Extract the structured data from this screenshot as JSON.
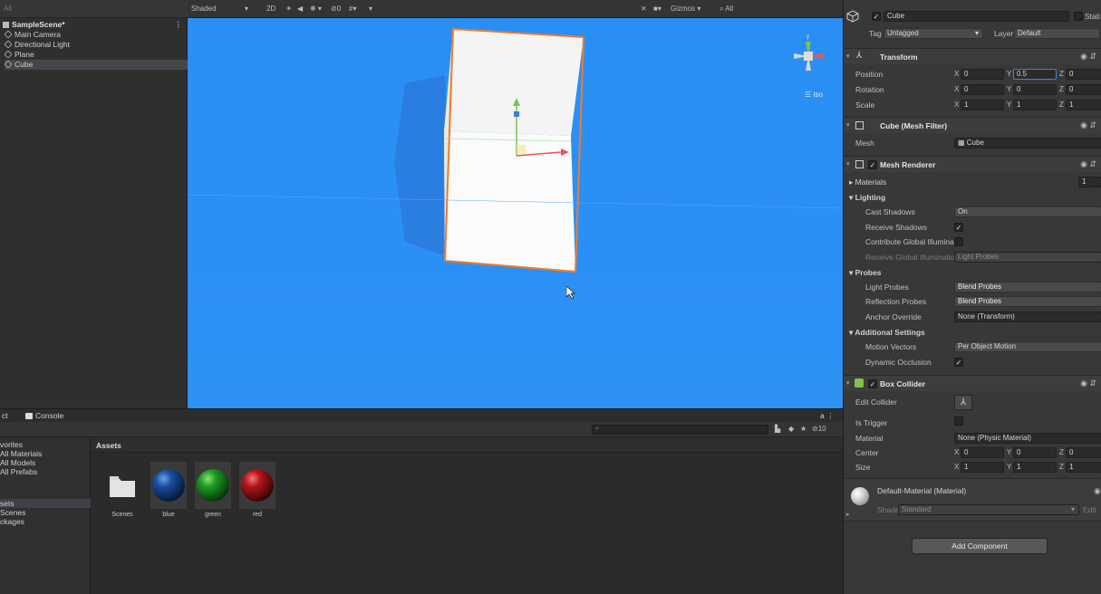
{
  "hierarchy": {
    "search_placeholder": "All",
    "scene_name": "SampleScene*",
    "items": [
      "Main Camera",
      "Directional Light",
      "Plane",
      "Cube"
    ],
    "selected": "Cube"
  },
  "scene_toolbar": {
    "shading_mode": "Shaded",
    "mode_2d": "2D",
    "gizmos": "Gizmos",
    "search": "All"
  },
  "scene_view": {
    "projection_label": "Iso",
    "background_color": "#2b90f5"
  },
  "project": {
    "tabs": [
      "ct",
      "Console"
    ],
    "favorites": [
      "vorites",
      "All Materials",
      "All Models",
      "All Prefabs"
    ],
    "assets_tree": [
      "sets",
      "Scenes",
      "ckages"
    ],
    "assets_header": "Assets",
    "hidden_count": "10",
    "assets": [
      {
        "name": "Scenes",
        "kind": "folder",
        "color": "#e8e8e8"
      },
      {
        "name": "blue",
        "kind": "material",
        "color": "#1b4fa0"
      },
      {
        "name": "green",
        "kind": "material",
        "color": "#1e9c22"
      },
      {
        "name": "red",
        "kind": "material",
        "color": "#b5161a"
      }
    ]
  },
  "inspector": {
    "object_name": "Cube",
    "static_label": "Stati",
    "tag_label": "Tag",
    "tag_value": "Untagged",
    "layer_label": "Layer",
    "layer_value": "Default",
    "transform": {
      "title": "Transform",
      "position_label": "Position",
      "rotation_label": "Rotation",
      "scale_label": "Scale",
      "position": {
        "x": "0",
        "y": "0.5",
        "z": "0"
      },
      "rotation": {
        "x": "0",
        "y": "0",
        "z": "0"
      },
      "scale": {
        "x": "1",
        "y": "1",
        "z": "1"
      }
    },
    "mesh_filter": {
      "title": "Cube (Mesh Filter)",
      "mesh_label": "Mesh",
      "mesh_value": "Cube"
    },
    "mesh_renderer": {
      "title": "Mesh Renderer",
      "materials_label": "Materials",
      "materials_count": "1",
      "lighting_label": "Lighting",
      "cast_shadows_label": "Cast Shadows",
      "cast_shadows_value": "On",
      "receive_shadows_label": "Receive Shadows",
      "contribute_gi_label": "Contribute Global Illuminat",
      "receive_gi_label": "Receive Global Illuminatior",
      "receive_gi_value": "Light Probes",
      "probes_label": "Probes",
      "light_probes_label": "Light Probes",
      "light_probes_value": "Blend Probes",
      "reflection_probes_label": "Reflection Probes",
      "reflection_probes_value": "Blend Probes",
      "anchor_override_label": "Anchor Override",
      "anchor_override_value": "None (Transform)",
      "additional_label": "Additional Settings",
      "motion_vectors_label": "Motion Vectors",
      "motion_vectors_value": "Per Object Motion",
      "dynamic_occlusion_label": "Dynamic Occlusion"
    },
    "box_collider": {
      "title": "Box Collider",
      "edit_collider_label": "Edit Collider",
      "is_trigger_label": "Is Trigger",
      "material_label": "Material",
      "material_value": "None (Physic Material)",
      "center_label": "Center",
      "size_label": "Size",
      "center": {
        "x": "0",
        "y": "0",
        "z": "0"
      },
      "size": {
        "x": "1",
        "y": "1",
        "z": "1"
      }
    },
    "material": {
      "title": "Default-Material (Material)",
      "shader_label": "Shader",
      "shader_value": "Standard",
      "edit_label": "Edit"
    },
    "add_component": "Add Component",
    "check": "✓"
  }
}
